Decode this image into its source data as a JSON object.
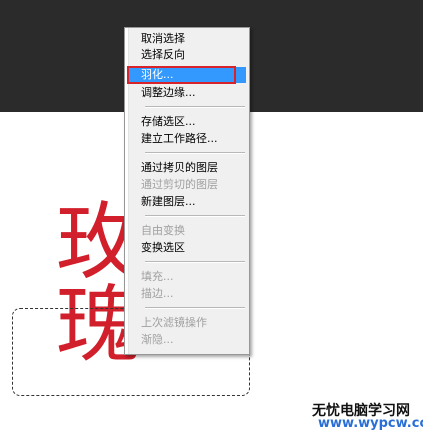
{
  "context_menu": {
    "items": [
      {
        "label": "取消选择",
        "disabled": false
      },
      {
        "label": "选择反向",
        "disabled": false
      },
      {
        "label": "羽化...",
        "disabled": false,
        "highlighted": true
      },
      {
        "label": "调整边缘...",
        "disabled": false
      },
      {
        "label": "存储选区...",
        "disabled": false
      },
      {
        "label": "建立工作路径...",
        "disabled": false
      },
      {
        "label": "通过拷贝的图层",
        "disabled": false
      },
      {
        "label": "通过剪切的图层",
        "disabled": true
      },
      {
        "label": "新建图层...",
        "disabled": false
      },
      {
        "label": "自由变换",
        "disabled": true
      },
      {
        "label": "变换选区",
        "disabled": false
      },
      {
        "label": "填充...",
        "disabled": true
      },
      {
        "label": "描边...",
        "disabled": true
      },
      {
        "label": "上次滤镜操作",
        "disabled": true
      },
      {
        "label": "渐隐...",
        "disabled": true
      }
    ]
  },
  "canvas": {
    "glyph_top": "玫",
    "glyph_bottom": "瑰",
    "glyph_color": "#d11f2b"
  },
  "watermark": {
    "line1": "无忧电脑学习网",
    "line2": "www.wypcw.com"
  },
  "colors": {
    "highlight": "#3399ff",
    "annotation_frame": "#d8232a",
    "menu_bg": "#f0f0f0",
    "dark_background": "#2b2b2b"
  }
}
